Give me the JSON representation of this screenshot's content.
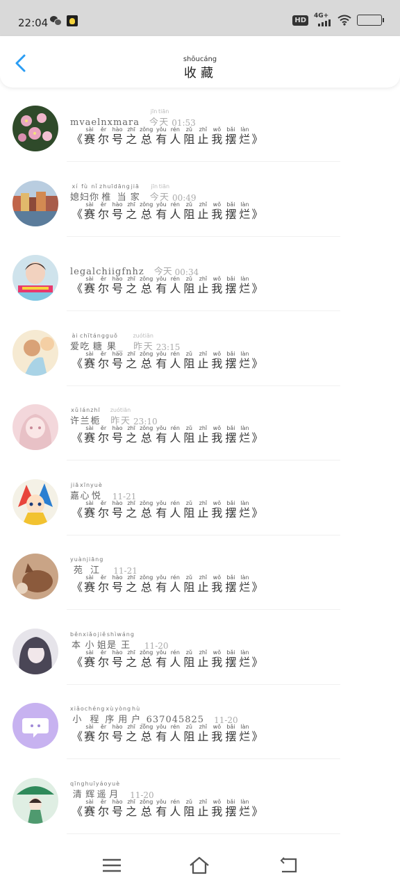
{
  "status_bar": {
    "time": "22:04",
    "network": "4G+",
    "hd_badge": "HD"
  },
  "header": {
    "title": [
      {
        "char": "收",
        "pinyin": "shōu"
      },
      {
        "char": "藏",
        "pinyin": "cáng"
      }
    ]
  },
  "title_words": [
    {
      "char": "赛",
      "pinyin": "sài"
    },
    {
      "char": "尔",
      "pinyin": "ěr"
    },
    {
      "char": "号",
      "pinyin": "hào"
    },
    {
      "char": "之",
      "pinyin": "zhī"
    },
    {
      "char": "总",
      "pinyin": "zǒng"
    },
    {
      "char": "有",
      "pinyin": "yǒu"
    },
    {
      "char": "人",
      "pinyin": "rén"
    },
    {
      "char": "阻",
      "pinyin": "zǔ"
    },
    {
      "char": "止",
      "pinyin": "zhǐ"
    },
    {
      "char": "我",
      "pinyin": "wǒ"
    },
    {
      "char": "摆",
      "pinyin": "bǎi"
    },
    {
      "char": "烂",
      "pinyin": "làn"
    }
  ],
  "items": [
    {
      "username": {
        "latin": "mvaelnxmara",
        "chars": []
      },
      "time": {
        "chars": [
          {
            "char": "今",
            "pinyin": "jīn"
          },
          {
            "char": "天",
            "pinyin": "tiān"
          }
        ],
        "text": "01:53"
      },
      "avatar": "pink-flowers"
    },
    {
      "username": {
        "latin": "",
        "chars": [
          {
            "char": "媳",
            "pinyin": "xí"
          },
          {
            "char": "妇",
            "pinyin": "fù"
          },
          {
            "char": "你",
            "pinyin": "nǐ"
          },
          {
            "char": "椎",
            "pinyin": "zhuī"
          },
          {
            "char": "当",
            "pinyin": "dāng"
          },
          {
            "char": "家",
            "pinyin": "jiā"
          }
        ]
      },
      "time": {
        "chars": [
          {
            "char": "今",
            "pinyin": "jīn"
          },
          {
            "char": "天",
            "pinyin": "tiān"
          }
        ],
        "text": "00:49"
      },
      "avatar": "city-waterfront"
    },
    {
      "username": {
        "latin": "legalchiigfnhz",
        "chars": []
      },
      "time": {
        "chars": [
          {
            "char": "今",
            "pinyin": ""
          },
          {
            "char": "天",
            "pinyin": ""
          }
        ],
        "text": "00:34"
      },
      "avatar": "young-man-portrait"
    },
    {
      "username": {
        "latin": "",
        "chars": [
          {
            "char": "爱",
            "pinyin": "ài"
          },
          {
            "char": "吃",
            "pinyin": "chī"
          },
          {
            "char": "糖",
            "pinyin": "táng"
          },
          {
            "char": "果",
            "pinyin": "guǒ"
          }
        ],
        "suffix": "_"
      },
      "time": {
        "chars": [
          {
            "char": "昨",
            "pinyin": "zuó"
          },
          {
            "char": "天",
            "pinyin": "tiān"
          }
        ],
        "text": "23:15"
      },
      "avatar": "anime-boy-warm"
    },
    {
      "username": {
        "latin": "",
        "chars": [
          {
            "char": "许",
            "pinyin": "xǔ"
          },
          {
            "char": "兰",
            "pinyin": "lán"
          },
          {
            "char": "栀",
            "pinyin": "zhī"
          }
        ]
      },
      "time": {
        "chars": [
          {
            "char": "昨",
            "pinyin": "zuó"
          },
          {
            "char": "天",
            "pinyin": "tiān"
          }
        ],
        "text": "23:10"
      },
      "avatar": "anime-girl-pink"
    },
    {
      "username": {
        "latin": "",
        "chars": [
          {
            "char": "嘉",
            "pinyin": "jiā"
          },
          {
            "char": "心",
            "pinyin": "xīn"
          },
          {
            "char": "悦",
            "pinyin": "yuè"
          }
        ]
      },
      "time": {
        "chars": [],
        "text": "11-21"
      },
      "avatar": "anime-colorful"
    },
    {
      "username": {
        "latin": "",
        "chars": [
          {
            "char": "苑",
            "pinyin": "yuàn"
          },
          {
            "char": "江",
            "pinyin": "jiāng"
          }
        ]
      },
      "time": {
        "chars": [],
        "text": "11-21"
      },
      "avatar": "cat-brown"
    },
    {
      "username": {
        "latin": "",
        "chars": [
          {
            "char": "本",
            "pinyin": "běn"
          },
          {
            "char": "小",
            "pinyin": "xiǎo"
          },
          {
            "char": "姐",
            "pinyin": "jiě"
          },
          {
            "char": "是",
            "pinyin": "shì"
          },
          {
            "char": "王",
            "pinyin": "wáng"
          }
        ]
      },
      "time": {
        "chars": [],
        "text": "11-20"
      },
      "avatar": "anime-girl-dark"
    },
    {
      "username": {
        "latin": "_637045825",
        "chars": [
          {
            "char": "小",
            "pinyin": "xiǎo"
          },
          {
            "char": "程",
            "pinyin": "chéng"
          },
          {
            "char": "序",
            "pinyin": "xù"
          },
          {
            "char": "用",
            "pinyin": "yòng"
          },
          {
            "char": "户",
            "pinyin": "hù"
          }
        ]
      },
      "time": {
        "chars": [],
        "text": "11-20"
      },
      "avatar": "default-chat-bubble"
    },
    {
      "username": {
        "latin": "",
        "chars": [
          {
            "char": "清",
            "pinyin": "qīng"
          },
          {
            "char": "辉",
            "pinyin": "huī"
          },
          {
            "char": "遥",
            "pinyin": "yáo"
          },
          {
            "char": "月",
            "pinyin": "yuè"
          }
        ]
      },
      "time": {
        "chars": [],
        "text": "11-20"
      },
      "avatar": "girl-green-umbrella"
    }
  ],
  "nav_bar": {
    "icons": [
      "menu-icon",
      "home-icon",
      "back-icon"
    ]
  },
  "colors": {
    "accent": "#2a9df4",
    "status_bar_bg": "#d9d9d9",
    "text_dark": "#333333",
    "text_muted": "#aaaaaa"
  }
}
